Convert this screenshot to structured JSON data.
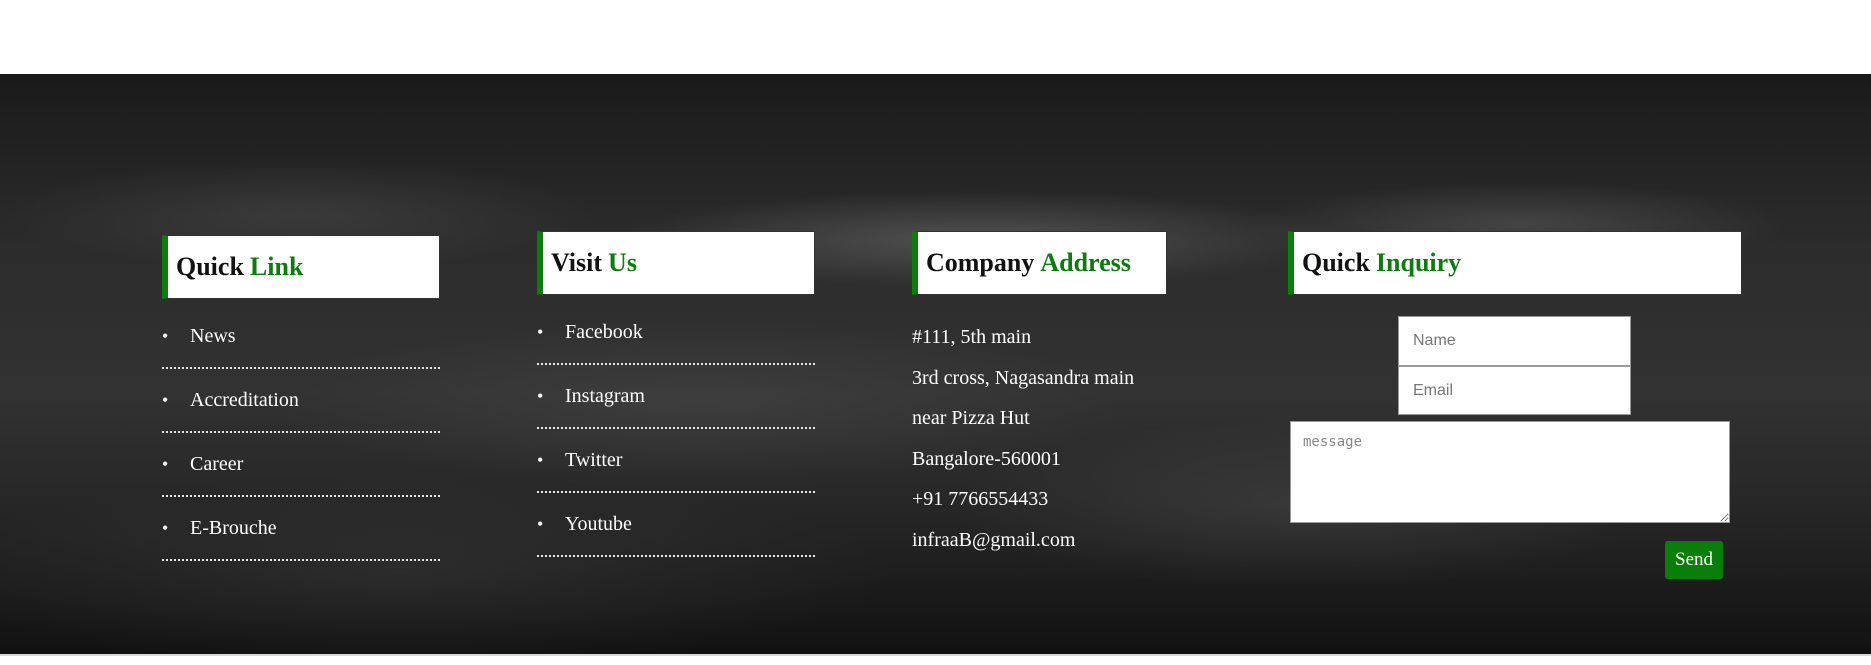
{
  "quick_link": {
    "title_main": "Quick",
    "title_accent": "Link",
    "items": [
      {
        "label": "News"
      },
      {
        "label": "Accreditation"
      },
      {
        "label": "Career"
      },
      {
        "label": "E-Brouche"
      }
    ]
  },
  "visit_us": {
    "title_main": "Visit",
    "title_accent": "Us",
    "items": [
      {
        "label": "Facebook"
      },
      {
        "label": "Instagram"
      },
      {
        "label": "Twitter"
      },
      {
        "label": "Youtube"
      }
    ]
  },
  "company_address": {
    "title_main": "Company",
    "title_accent": "Address",
    "lines": [
      "#111, 5th main",
      "3rd cross, Nagasandra main",
      "near Pizza Hut",
      "Bangalore-560001",
      "+91 7766554433",
      "infraaB@gmail.com"
    ]
  },
  "quick_inquiry": {
    "title_main": "Quick",
    "title_accent": "Inquiry",
    "name_placeholder": "Name",
    "email_placeholder": "Email",
    "message_placeholder": "message",
    "send_label": "Send"
  },
  "colors": {
    "accent": "#0b7d0b",
    "text": "#ffffff"
  }
}
